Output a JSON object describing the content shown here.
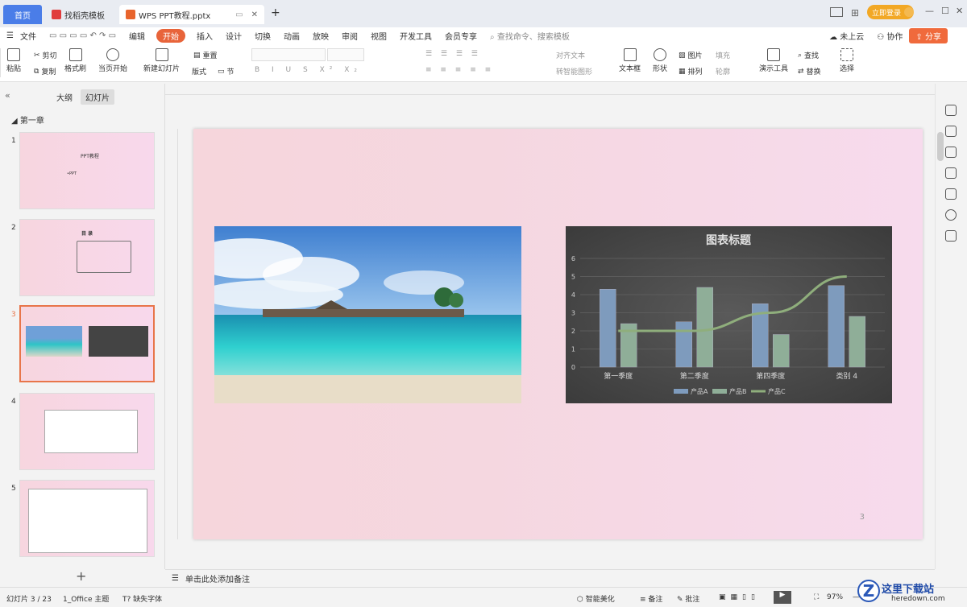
{
  "titlebar": {
    "home_tab": "首页",
    "template_tab": "找稻壳模板",
    "doc_tab": "WPS PPT教程.pptx",
    "new_tab": "+",
    "login": "立即登录"
  },
  "menubar": {
    "file": "文件",
    "edit": "编辑",
    "items": [
      "开始",
      "插入",
      "设计",
      "切换",
      "动画",
      "放映",
      "审阅",
      "视图",
      "开发工具",
      "会员专享"
    ],
    "search": "查找命令、搜索模板",
    "cloud": "未上云",
    "collab": "协作",
    "share": "分享"
  },
  "ribbon": {
    "paste": "粘贴",
    "cut": "剪切",
    "copy": "复制",
    "format_painter": "格式刷",
    "play_from_current": "当页开始",
    "new_slide": "新建幻灯片",
    "layout": "版式",
    "section": "节",
    "reset": "重置",
    "align_text": "对齐文本",
    "convert_smartart": "转智能图形",
    "textbox": "文本框",
    "shape": "形状",
    "picture": "图片",
    "arrange": "排列",
    "fill": "填充",
    "outline": "轮廓",
    "present_tools": "演示工具",
    "find": "查找",
    "replace": "替换",
    "select": "选择"
  },
  "leftpane": {
    "outline_tab": "大纲",
    "slides_tab": "幻灯片",
    "chapter": "第一章",
    "slide_numbers": [
      "1",
      "2",
      "3",
      "4",
      "5"
    ],
    "slide1_title": "PPT教程",
    "slide1_sub": "•PPT",
    "slide2_title": "目 录"
  },
  "slide": {
    "page_number": "3"
  },
  "chart_data": {
    "type": "bar",
    "title": "图表标题",
    "categories": [
      "第一季度",
      "第二季度",
      "第四季度",
      "类别 4"
    ],
    "series": [
      {
        "name": "产品A",
        "type": "bar",
        "values": [
          4.3,
          2.5,
          3.5,
          4.5
        ],
        "color": "#7e9bbd"
      },
      {
        "name": "产品B",
        "type": "bar",
        "values": [
          2.4,
          4.4,
          1.8,
          2.8
        ],
        "color": "#8fae98"
      },
      {
        "name": "产品C",
        "type": "line",
        "values": [
          2,
          2,
          3,
          5
        ],
        "color": "#8fae7c"
      }
    ],
    "ylim": [
      0,
      6
    ],
    "yticks": [
      0,
      1,
      2,
      3,
      4,
      5,
      6
    ],
    "grid": true,
    "legend": "bottom"
  },
  "notes": {
    "placeholder": "单击此处添加备注"
  },
  "status": {
    "slide_count": "幻灯片 3 / 23",
    "theme": "1_Office 主题",
    "missing_font": "缺失字体",
    "beautify": "智能美化",
    "notes": "备注",
    "comments": "批注",
    "zoom": "97%"
  },
  "watermark": {
    "text": "这里下载站",
    "domain": "heredown.com"
  }
}
